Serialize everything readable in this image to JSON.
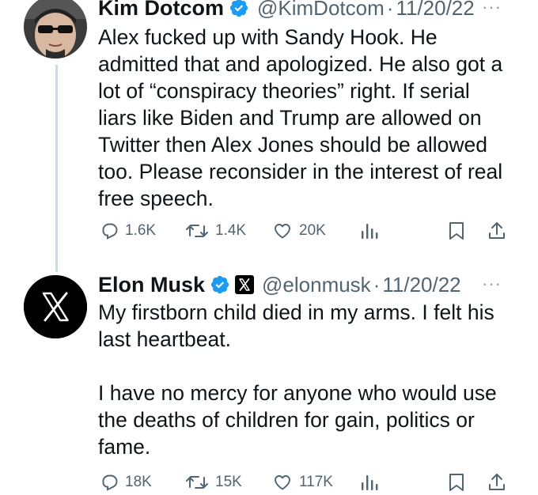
{
  "tweets": [
    {
      "name": "Kim Dotcom",
      "handle": "@KimDotcom",
      "separator": "·",
      "date": "11/20/22",
      "more": "···",
      "text": [
        "Alex fucked up with Sandy Hook. He admitted that and apologized. He also got a lot of “conspiracy theories” right. If serial liars like Biden and Trump are allowed on Twitter then Alex Jones should be allowed too. Please reconsider in the interest of real free speech."
      ],
      "replies": "1.6K",
      "retweets": "1.4K",
      "likes": "20K",
      "icons": [
        "verified-badge-icon",
        "reply-icon",
        "retweet-icon",
        "like-icon",
        "views-icon",
        "bookmark-icon",
        "share-icon"
      ]
    },
    {
      "name": "Elon Musk",
      "handle": "@elonmusk",
      "separator": "·",
      "date": "11/20/22",
      "more": "···",
      "text": [
        "My firstborn child died in my arms. I felt his last heartbeat.",
        "I have no mercy for anyone who would use the deaths of children for gain, politics or fame."
      ],
      "replies": "18K",
      "retweets": "15K",
      "likes": "117K",
      "icons": [
        "verified-badge-icon",
        "x-logo-icon",
        "reply-icon",
        "retweet-icon",
        "like-icon",
        "views-icon",
        "bookmark-icon",
        "share-icon"
      ]
    }
  ],
  "colors": {
    "verified": "#1d9bf0",
    "muted": "#536471",
    "text": "#0f1419",
    "thread_line": "#cfd9de",
    "x_logo_bg": "#000000"
  }
}
